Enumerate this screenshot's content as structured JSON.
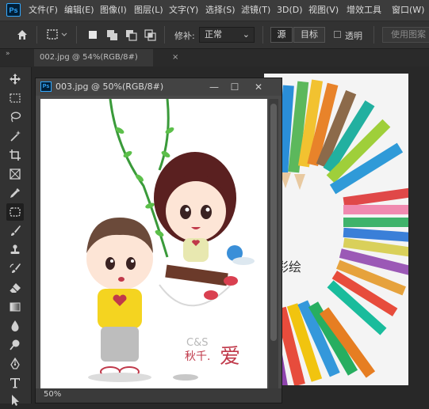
{
  "app": {
    "logo": "Ps"
  },
  "menu": [
    "文件(F)",
    "编辑(E)",
    "图像(I)",
    "图层(L)",
    "文字(Y)",
    "选择(S)",
    "滤镜(T)",
    "3D(D)",
    "视图(V)",
    "增效工具",
    "窗口(W)"
  ],
  "options": {
    "feather_label": "修补:",
    "style_value": "正常",
    "source_label": "源",
    "dest_label": "目标",
    "transparent_label": "透明",
    "use_pattern_label": "使用图案"
  },
  "tabs": [
    {
      "label": "002.jpg @ 54%(RGB/8#)",
      "close": "×"
    }
  ],
  "panel_collapse": "»",
  "tools": [
    "move-tool",
    "marquee-tool",
    "lasso-tool",
    "magic-wand-tool",
    "crop-tool",
    "frame-tool",
    "eyedropper-tool",
    "patch-tool",
    "brush-tool",
    "clone-stamp-tool",
    "history-brush-tool",
    "eraser-tool",
    "gradient-tool",
    "blur-tool",
    "dodge-tool",
    "pen-tool",
    "type-tool",
    "path-select-tool"
  ],
  "active_tool": "patch-tool",
  "document_window": {
    "title": "003.jpg @ 50%(RGB/8#)",
    "icon": "Ps",
    "minimize": "—",
    "maximize": "☐",
    "close": "✕",
    "zoom": "50%",
    "logo_text_latin": "C&S",
    "logo_text_cn_1": "秋千.",
    "logo_text_cn_2": "爱"
  },
  "background_document": {
    "caption": "彩绘"
  },
  "colors": {
    "accent": "#31a8ff",
    "menubar": "#3c3c3c",
    "panel": "#323232",
    "canvas": "#282828"
  }
}
